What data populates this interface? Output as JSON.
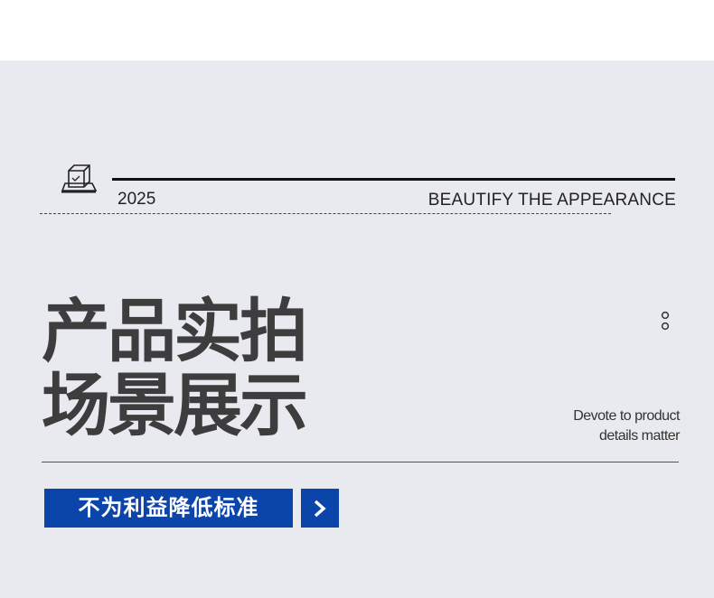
{
  "header": {
    "year": "2025",
    "tagline_en": "BEAUTIFY THE APPEARANCE",
    "icon": "scale-box-icon"
  },
  "hero": {
    "title_line1": "产品实拍",
    "title_line2": "场景展示",
    "subtitle_line1": "Devote to product",
    "subtitle_line2": "details matter",
    "dots_icon": "dots-icon"
  },
  "cta": {
    "label": "不为利益降低标准",
    "arrow_icon": "chevron-right-icon"
  },
  "colors": {
    "panel_bg": "#e9eaef",
    "accent_blue": "#0b45aa",
    "title_text": "#3d3d3d"
  }
}
